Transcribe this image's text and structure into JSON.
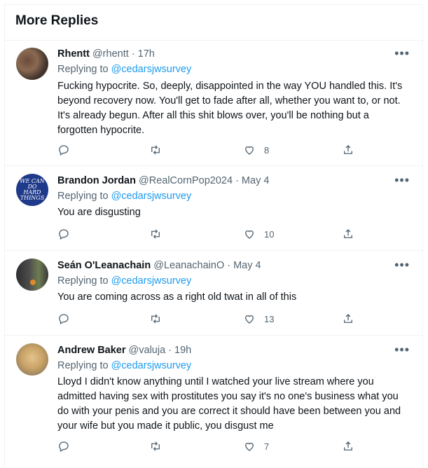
{
  "heading": "More Replies",
  "more_glyph": "•••",
  "replies": [
    {
      "name": "Rhentt",
      "handle": "@rhentt · 17h",
      "replying_prefix": "Replying to ",
      "replying_to": "@cedarsjwsurvey",
      "text": "Fucking hypocrite. So, deeply, disappointed in the way YOU handled this. It's beyond recovery now. You'll get to fade after all, whether you want to, or not. It's already begun. After all this shit blows over, you'll be nothing but a forgotten hypocrite.",
      "likes": "8"
    },
    {
      "name": "Brandon Jordan",
      "handle": "@RealCornPop2024 · May 4",
      "replying_prefix": "Replying to ",
      "replying_to": "@cedarsjwsurvey",
      "text": "You are disgusting",
      "likes": "10",
      "avatar_text": "WE CAN DO HARD THINGS"
    },
    {
      "name": "Seán O'Leanachain",
      "handle": "@LeanachainO · May 4",
      "replying_prefix": "Replying to ",
      "replying_to": "@cedarsjwsurvey",
      "text": "You are coming across as a right old twat in all of this",
      "likes": "13"
    },
    {
      "name": "Andrew Baker",
      "handle": "@valuja · 19h",
      "replying_prefix": "Replying to ",
      "replying_to": "@cedarsjwsurvey",
      "text": "Lloyd I didn't know anything until I watched your live stream where you admitted having sex with prostitutes you say it's no one's business what you do with your penis and you are correct it should have been between you and your wife but you made it public, you disgust me",
      "likes": "7"
    }
  ],
  "colors": {
    "link": "#1d9bf0",
    "muted": "#536471",
    "text": "#0f1419",
    "divider": "#eff3f4"
  }
}
